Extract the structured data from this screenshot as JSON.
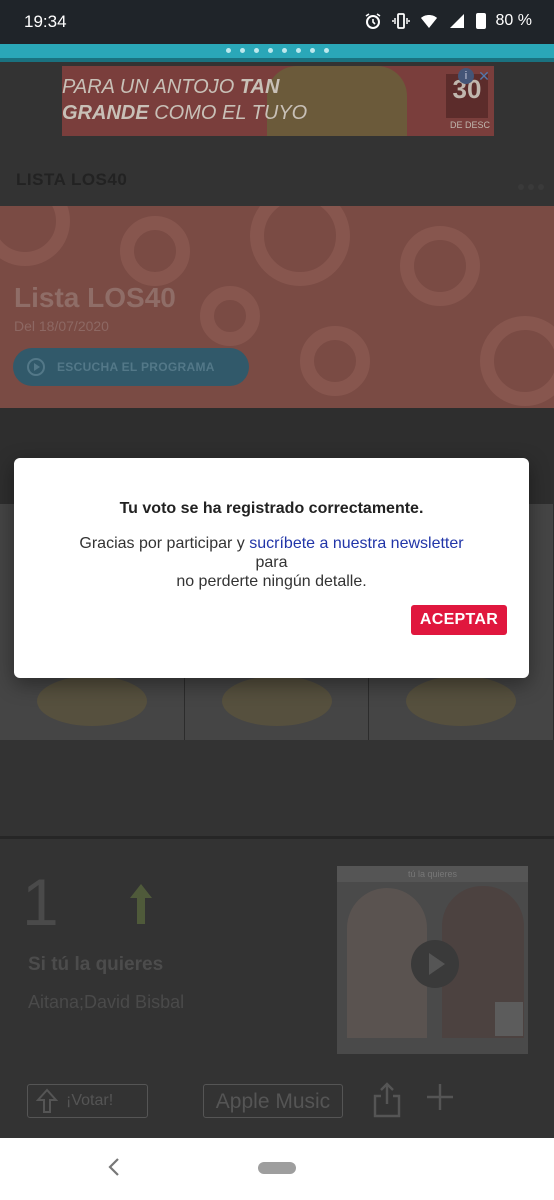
{
  "status_bar": {
    "time": "19:34",
    "battery": "80 %"
  },
  "ad": {
    "line1_prefix": "PARA UN ANTOJO ",
    "line1_bold": "TAN",
    "line2_bold": "GRANDE",
    "line2_suffix": " COMO EL TUYO",
    "discount": "30",
    "discount_label": "DE DESC"
  },
  "header": {
    "title": "LISTA LOS40"
  },
  "hero": {
    "title": "Lista LOS40",
    "date": "Del 18/07/2020",
    "button_label": "ESCUCHA EL PROGRAMA"
  },
  "entry": {
    "rank": "1",
    "song": "Si tú la quieres",
    "artist": "Aitana;David Bisbal",
    "thumb_caption": "tú la quieres",
    "vote_label": "¡Votar!",
    "apple_label": "Apple Music"
  },
  "dialog": {
    "title": "Tu voto se ha registrado correctamente.",
    "text_before": "Gracias por participar y ",
    "link": "sucríbete a nuestra newsletter",
    "text_mid": "para",
    "text_after": "no perderte ningún detalle.",
    "ok_label": "ACEPTAR"
  },
  "colors": {
    "accent": "#e0173e",
    "link": "#2135a8",
    "brand_cyan": "#2aa7b8"
  }
}
